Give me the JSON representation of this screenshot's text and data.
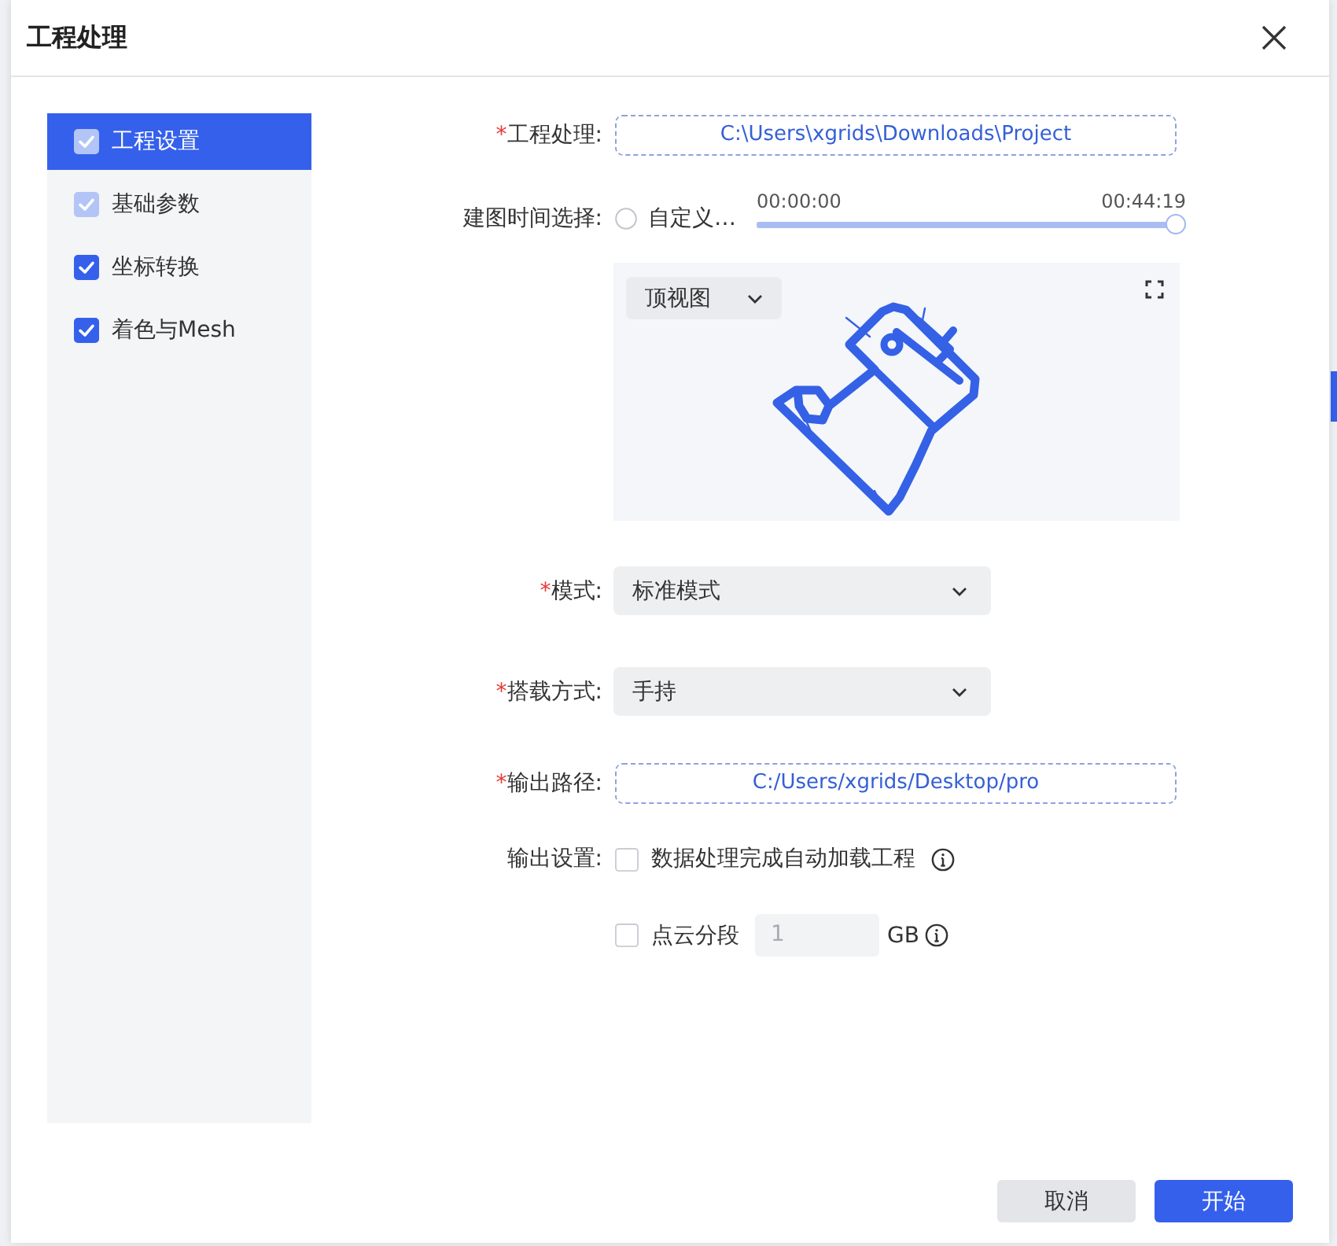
{
  "window": {
    "title": "工程处理"
  },
  "sidebar": {
    "items": [
      {
        "label": "工程设置",
        "selected": true,
        "checked": true,
        "disabled": true
      },
      {
        "label": "基础参数",
        "selected": false,
        "checked": true,
        "disabled": true
      },
      {
        "label": "坐标转换",
        "selected": false,
        "checked": true,
        "disabled": false
      },
      {
        "label": "着色与Mesh",
        "selected": false,
        "checked": true,
        "disabled": false
      }
    ]
  },
  "form": {
    "fields": [
      {
        "kind": "path",
        "required_mark": "*",
        "label": "工程处理:",
        "value": "C:\\Users\\xgrids\\Downloads\\Project"
      },
      {
        "kind": "time_range",
        "label": "建图时间选择:",
        "radio": {
          "label": "自定义…",
          "selected": false
        },
        "start": "00:00:00",
        "end": "00:44:19",
        "level": 1
      },
      {
        "kind": "preview",
        "view_select": {
          "value": "顶视图"
        }
      },
      {
        "kind": "select",
        "required_mark": "*",
        "label": "模式:",
        "value": "标准模式"
      },
      {
        "kind": "select",
        "required_mark": "*",
        "label": "搭载方式:",
        "value": "手持"
      },
      {
        "kind": "path",
        "required_mark": "*",
        "label": "输出路径:",
        "value": "C:/Users/xgrids/Desktop/pro"
      },
      {
        "kind": "checkbox",
        "label": "输出设置:",
        "option": "数据处理完成自动加载工程",
        "checked": false
      },
      {
        "kind": "segment",
        "option": "点云分段",
        "checked": false,
        "input": {
          "value": "1",
          "disabled": true
        },
        "unit": "GB"
      }
    ]
  },
  "footer": {
    "buttons": [
      {
        "label": "取消",
        "kind": "secondary"
      },
      {
        "label": "开始",
        "kind": "primary"
      }
    ]
  }
}
